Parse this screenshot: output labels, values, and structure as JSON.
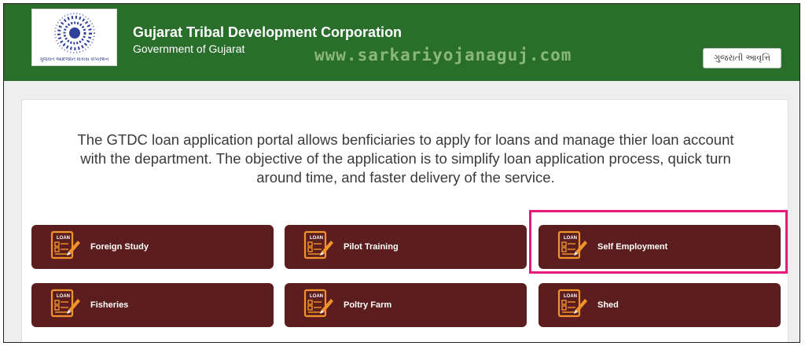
{
  "header": {
    "logo_text": "ગુજરાત આદિજાતિ વિકાસ કોર્પોરેશન",
    "title": "Gujarat Tribal Development Corporation",
    "subtitle": "Government of Gujarat",
    "watermark": "www.sarkariyojanaguj.com",
    "language_button": "ગુજરાતી આવૃત્તિ"
  },
  "main": {
    "description": "The GTDC loan application portal allows benficiaries to apply for loans and manage thier loan account with the department. The objective of the application is to simplify loan application process, quick turn around time, and faster delivery of the service.",
    "tiles": [
      {
        "label": "Foreign Study",
        "icon": "loan-document-icon"
      },
      {
        "label": "Pilot Training",
        "icon": "loan-document-icon"
      },
      {
        "label": "Self Employment",
        "icon": "loan-document-icon"
      },
      {
        "label": "Fisheries",
        "icon": "loan-document-icon"
      },
      {
        "label": "Poltry Farm",
        "icon": "loan-document-icon"
      },
      {
        "label": "Shed",
        "icon": "loan-document-icon"
      }
    ],
    "icon_caption": "LOAN"
  },
  "colors": {
    "header_bg": "#2a6e2c",
    "tile_bg": "#5b1d1d",
    "highlight": "#e8197a",
    "icon_orange": "#f0932b"
  }
}
